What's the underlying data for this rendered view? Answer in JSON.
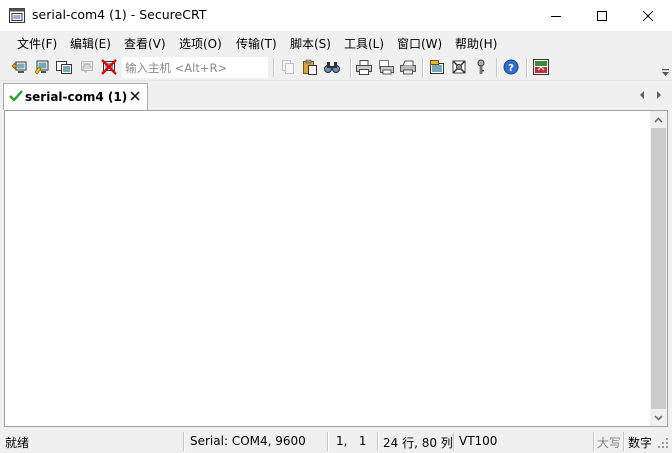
{
  "window": {
    "title": "serial-com4 (1) - SecureCRT",
    "app_icon": "securecrt-terminal-icon"
  },
  "menu": {
    "items": [
      {
        "label": "文件(F)"
      },
      {
        "label": "编辑(E)"
      },
      {
        "label": "查看(V)"
      },
      {
        "label": "选项(O)"
      },
      {
        "label": "传输(T)"
      },
      {
        "label": "脚本(S)"
      },
      {
        "label": "工具(L)"
      },
      {
        "label": "窗口(W)"
      },
      {
        "label": "帮助(H)"
      }
    ]
  },
  "toolbar": {
    "quick_connect_placeholder": "输入主机 <Alt+R>",
    "icons": [
      "connect-icon",
      "quick-connect-icon",
      "connect-in-tab-icon",
      "reconnect-icon",
      "disconnect-icon",
      "copy-icon",
      "paste-icon",
      "find-icon",
      "print-icon",
      "print-selection-icon",
      "print-setup-icon",
      "session-options-icon",
      "global-options-icon",
      "keymap-icon",
      "help-icon",
      "sftp-icon"
    ]
  },
  "tabs": [
    {
      "label": "serial-com4 (1)",
      "status": "connected"
    }
  ],
  "statusbar": {
    "ready": "就绪",
    "connection": "Serial: COM4, 9600",
    "cursor": "1,   1",
    "size": "24 行, 80 列",
    "emulation": "VT100",
    "caps": "大写",
    "num": "数字"
  },
  "colors": {
    "chrome": "#f0f0f0",
    "terminal_bg": "#ffffff",
    "connected_check": "#2e9e2e"
  }
}
